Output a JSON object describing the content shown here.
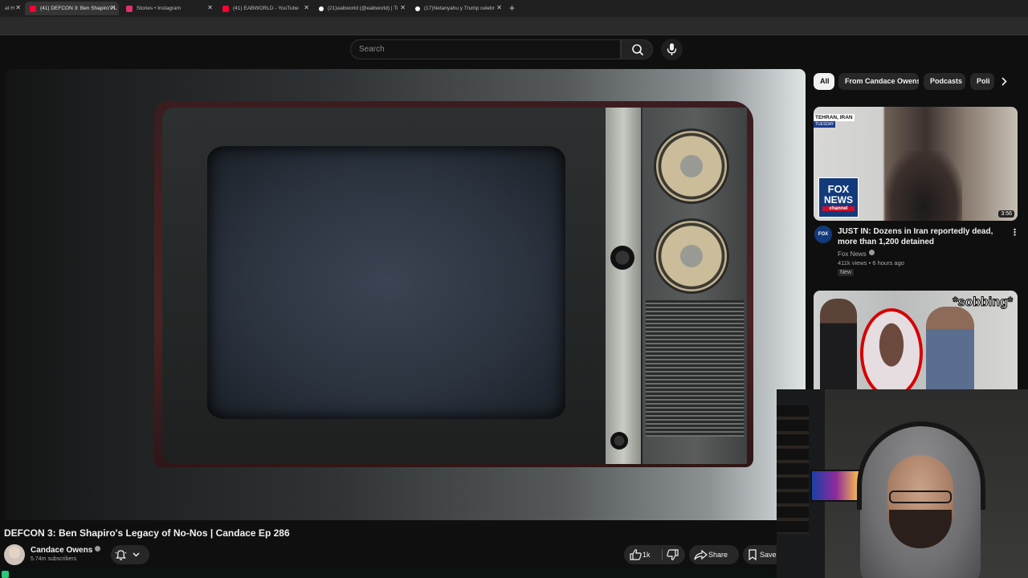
{
  "tabs": [
    {
      "title": "at H",
      "active": false,
      "color": "#888888"
    },
    {
      "title": "(41) DEFCON 3: Ben Shapiro's L",
      "active": true,
      "color": "#ff0033"
    },
    {
      "title": "Stories • Instagram",
      "active": false,
      "color": "#e1306c"
    },
    {
      "title": "(41) EABWORLD - YouTube",
      "active": false,
      "color": "#ff0033"
    },
    {
      "title": "(21)eabworld (@eabworld) | Ti",
      "active": false,
      "color": "#ffffff"
    },
    {
      "title": "(17)Netanyahu y Trump celebr",
      "active": false,
      "color": "#ffffff"
    }
  ],
  "search": {
    "placeholder": "Search"
  },
  "video": {
    "title": "DEFCON 3: Ben Shapiro's Legacy of No-Nos | Candace Ep 286",
    "channel": "Candace Owens",
    "subscribers": "5.74m subscribers",
    "likes": "1k",
    "share_label": "Share",
    "save_label": "Save"
  },
  "chips": [
    {
      "label": "All",
      "selected": true
    },
    {
      "label": "From Candace Owens",
      "selected": false
    },
    {
      "label": "Podcasts",
      "selected": false
    },
    {
      "label": "Poli",
      "selected": false
    }
  ],
  "recommended": [
    {
      "title": "JUST IN: Dozens in Iran reportedly dead, more than 1,200 detained",
      "channel": "Fox News",
      "meta": "411k views • 6 hours ago",
      "badge": "New",
      "duration": "3:56",
      "thumb_location": "TEHRAN, IRAN",
      "thumb_day": "TUESDAY",
      "logo_lines": [
        "FOX",
        "NEWS",
        "channel"
      ]
    },
    {
      "thumb_caption": "*sobbing*"
    }
  ],
  "icons": {
    "search": "search-icon",
    "mic": "mic-icon",
    "bell": "bell-icon",
    "like": "thumbs-up-icon",
    "dislike": "thumbs-down-icon",
    "share": "share-icon",
    "save": "save-icon"
  },
  "colors": {
    "accent": "#ff0033",
    "background": "#0f0f0f",
    "chip_bg": "#272727"
  }
}
